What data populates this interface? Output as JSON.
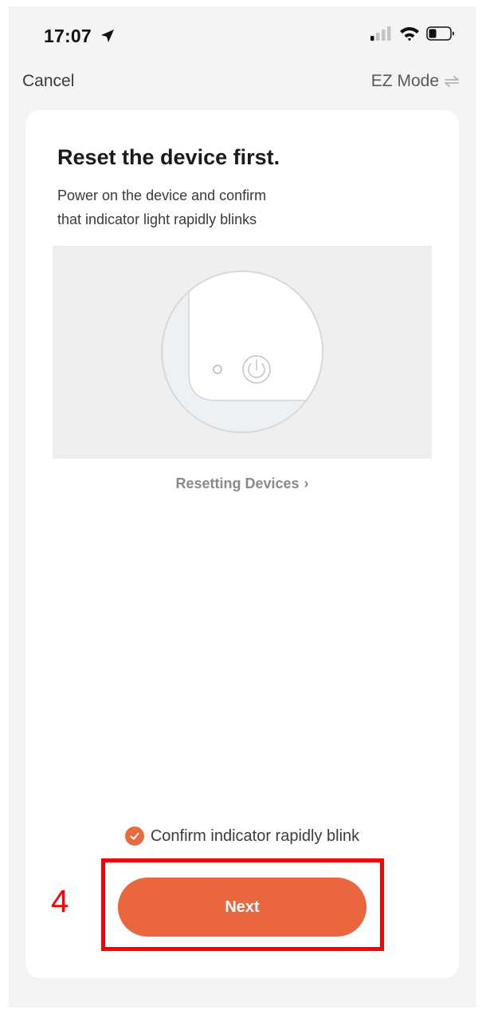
{
  "status_bar": {
    "time": "17:07"
  },
  "nav": {
    "cancel_label": "Cancel",
    "mode_label": "EZ Mode",
    "mode_icon": "swap-arrows-icon"
  },
  "card": {
    "title": "Reset the device first.",
    "description_line1": "Power on the device and confirm",
    "description_line2": "that indicator light rapidly blinks",
    "reset_link_label": "Resetting Devices",
    "confirm_label": "Confirm indicator rapidly blink",
    "confirm_checked": true,
    "next_label": "Next"
  },
  "annotation": {
    "number": "4",
    "color": "#ff0000"
  },
  "colors": {
    "accent": "#ea663e",
    "background": "#f4f4f4",
    "card": "#ffffff"
  }
}
